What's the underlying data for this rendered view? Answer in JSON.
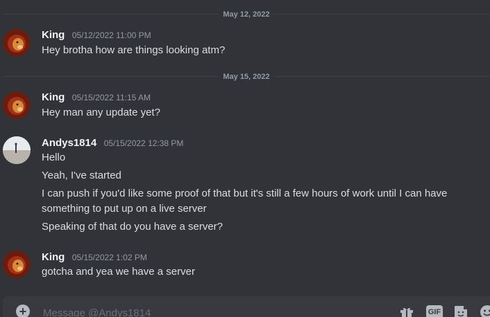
{
  "dividers": [
    "May 12, 2022",
    "May 15, 2022"
  ],
  "messages": [
    {
      "author": "King",
      "timestamp": "05/12/2022 11:00 PM",
      "lines": [
        "Hey brotha how are things looking atm?"
      ]
    },
    {
      "author": "King",
      "timestamp": "05/15/2022 11:15 AM",
      "lines": [
        "Hey man any update yet?"
      ]
    },
    {
      "author": "Andys1814",
      "timestamp": "05/15/2022 12:38 PM",
      "lines": [
        "Hello",
        "Yeah, I've started",
        "I can push if you'd like some proof of that but it's still a few hours of work until I can have something to put up on a live server",
        "Speaking of that do you have a server?"
      ]
    },
    {
      "author": "King",
      "timestamp": "05/15/2022 1:02 PM",
      "lines": [
        "gotcha and yea we have a server"
      ]
    }
  ],
  "composer": {
    "placeholder": "Message @Andys1814",
    "value": "",
    "add_icon": "plus-circle-icon",
    "tools": [
      "gift-icon",
      "gif-icon",
      "sticker-icon",
      "emoji-icon"
    ],
    "gif_label": "GIF"
  },
  "colors": {
    "background": "#313338",
    "username": "#f2f3f5",
    "text": "#dbdee1",
    "muted": "#949ba4",
    "composer": "#383a40"
  }
}
